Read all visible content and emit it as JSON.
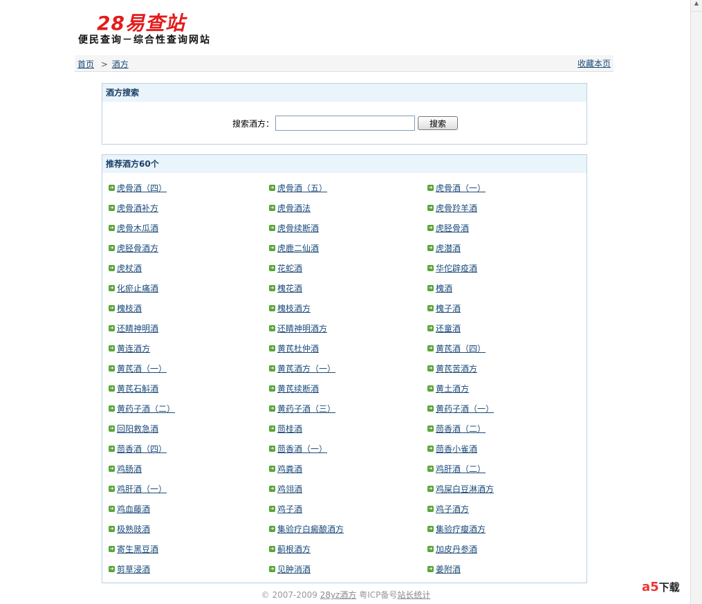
{
  "header": {
    "logo": "28易查站",
    "slogan": "便民查询－综合性查询网站"
  },
  "breadcrumb": {
    "home": "首页",
    "sep": ">",
    "current": "酒方",
    "bookmark": "收藏本页"
  },
  "search": {
    "title": "酒方搜索",
    "label": "搜索酒方：",
    "value": "",
    "button": "搜索"
  },
  "list": {
    "title": "推荐酒方60个",
    "items": [
      "虎骨酒（四）",
      "虎骨酒（五）",
      "虎骨酒（一）",
      "虎骨酒补方",
      "虎骨酒法",
      "虎骨羚羊酒",
      "虎骨木瓜酒",
      "虎骨续断酒",
      "虎胫骨酒",
      "虎胫骨酒方",
      "虎鹿二仙酒",
      "虎潜酒",
      "虎杖酒",
      "花蛇酒",
      "华佗辟疫酒",
      "化瘀止痛酒",
      "槐花酒",
      "槐酒",
      "槐枝酒",
      "槐枝酒方",
      "槐子酒",
      "还睛神明酒",
      "还睛神明酒方",
      "还童酒",
      "黄连酒方",
      "黄芪杜仲酒",
      "黄芪酒（四）",
      "黄芪酒（一）",
      "黄芪酒方（一）",
      "黄芪苦酒方",
      "黄芪石斛酒",
      "黄芪续断酒",
      "黄土酒方",
      "黄药子酒（二）",
      "黄药子酒（三）",
      "黄药子酒（一）",
      "回阳救急酒",
      "茴桂酒",
      "茴香酒（二）",
      "茴香酒（四）",
      "茴香酒（一）",
      "茴香小雀酒",
      "鸡肠酒",
      "鸡粪酒",
      "鸡肝酒（二）",
      "鸡肝酒（一）",
      "鸡翎酒",
      "鸡屎白豆淋酒方",
      "鸡血藤酒",
      "鸡子酒",
      "鸡子酒方",
      "极熟豉酒",
      "集验疗白癜酿酒方",
      "集验疗瘿酒方",
      "寄生黑豆酒",
      "蓟根酒方",
      "加皮丹参酒",
      "剪草浸酒",
      "见肿消酒",
      "姜附酒"
    ]
  },
  "footer": {
    "copyright": "© 2007-2009",
    "site": "28yz酒方",
    "icp": "粤ICP备号",
    "stats": "站长统计"
  },
  "watermark": {
    "brand": "a5",
    "text": "下载"
  }
}
